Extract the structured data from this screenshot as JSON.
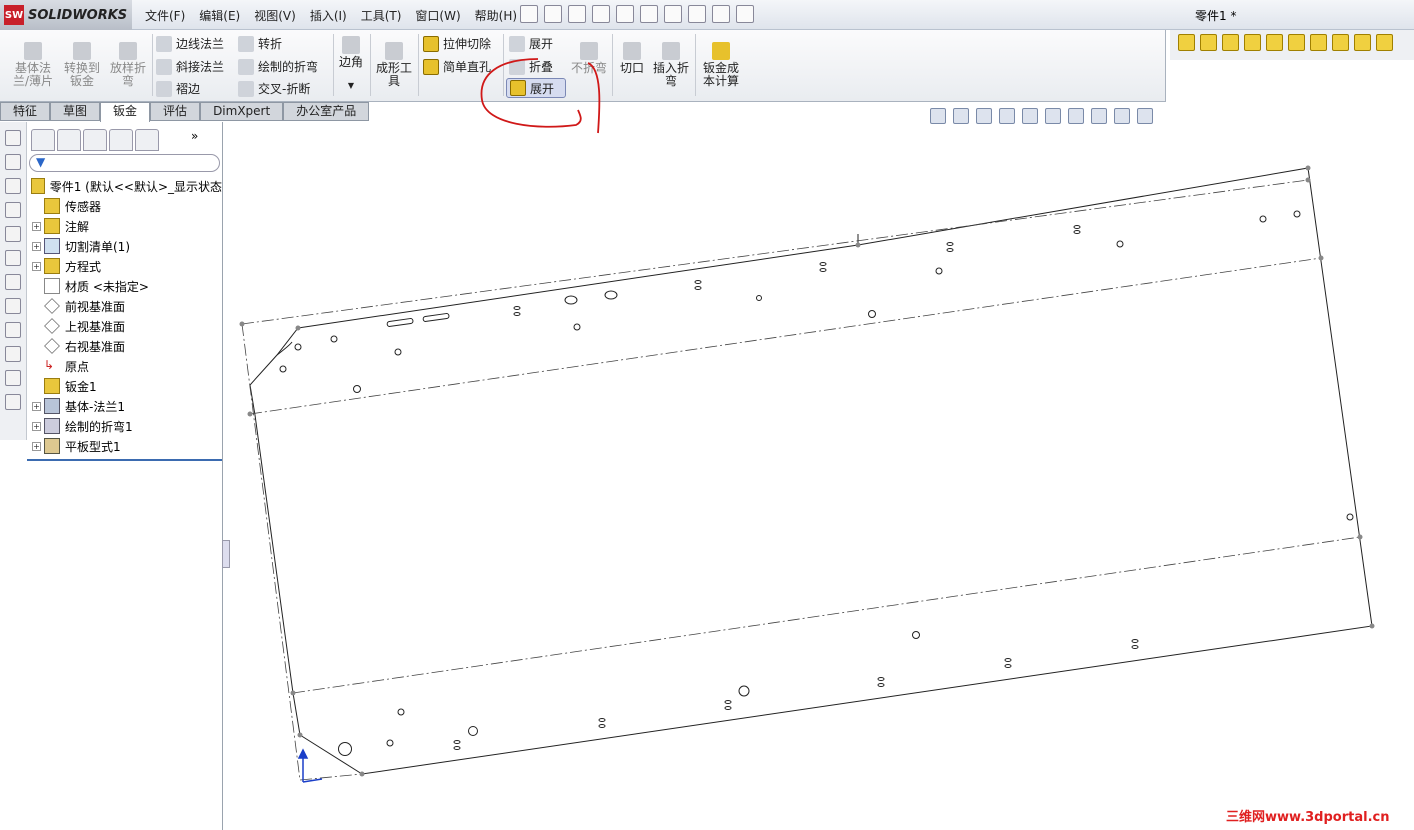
{
  "app": {
    "logo": "SOLIDWORKS",
    "logo_badge": "SW",
    "document_title": "零件1 *"
  },
  "menu": [
    "文件(F)",
    "编辑(E)",
    "视图(V)",
    "插入(I)",
    "工具(T)",
    "窗口(W)",
    "帮助(H)"
  ],
  "ribbon": {
    "base_flange": "基体法兰/薄片",
    "convert": "转换到钣金",
    "lofted_bend": "放样折弯",
    "edge_flange": "边线法兰",
    "jog": "转折",
    "miter_flange": "斜接法兰",
    "sketched_bend": "绘制的折弯",
    "hem": "褶边",
    "cross_break": "交叉-折断",
    "corner": "边角",
    "forming_tool": "成形工具",
    "extruded_cut": "拉伸切除",
    "simple_hole": "简单直孔",
    "unfold": "展开",
    "fold": "折叠",
    "no_bends": "不折弯",
    "flatten": "展开",
    "vent": "切口",
    "insert_bends": "插入折弯",
    "costing": "钣金成本计算"
  },
  "tabs": [
    {
      "label": "特征"
    },
    {
      "label": "草图"
    },
    {
      "label": "钣金",
      "active": true
    },
    {
      "label": "评估"
    },
    {
      "label": "DimXpert"
    },
    {
      "label": "办公室产品"
    }
  ],
  "tree": {
    "root": "零件1 (默认<<默认>_显示状态",
    "items": [
      {
        "label": "传感器",
        "expand": false
      },
      {
        "label": "注解",
        "expand": true
      },
      {
        "label": "切割清单(1)",
        "expand": true
      },
      {
        "label": "方程式",
        "expand": true
      },
      {
        "label": "材质 <未指定>",
        "expand": false
      },
      {
        "label": "前视基准面",
        "expand": false,
        "plane": true
      },
      {
        "label": "上视基准面",
        "expand": false,
        "plane": true
      },
      {
        "label": "右视基准面",
        "expand": false,
        "plane": true
      },
      {
        "label": "原点",
        "expand": false
      },
      {
        "label": "钣金1",
        "expand": false
      },
      {
        "label": "基体-法兰1",
        "expand": true
      },
      {
        "label": "绘制的折弯1",
        "expand": true
      },
      {
        "label": "平板型式1",
        "expand": true
      }
    ]
  },
  "watermark": "三维网www.3dportal.cn",
  "colors": {
    "annotation": "#d01818",
    "active_button": "#d6dcf0"
  }
}
